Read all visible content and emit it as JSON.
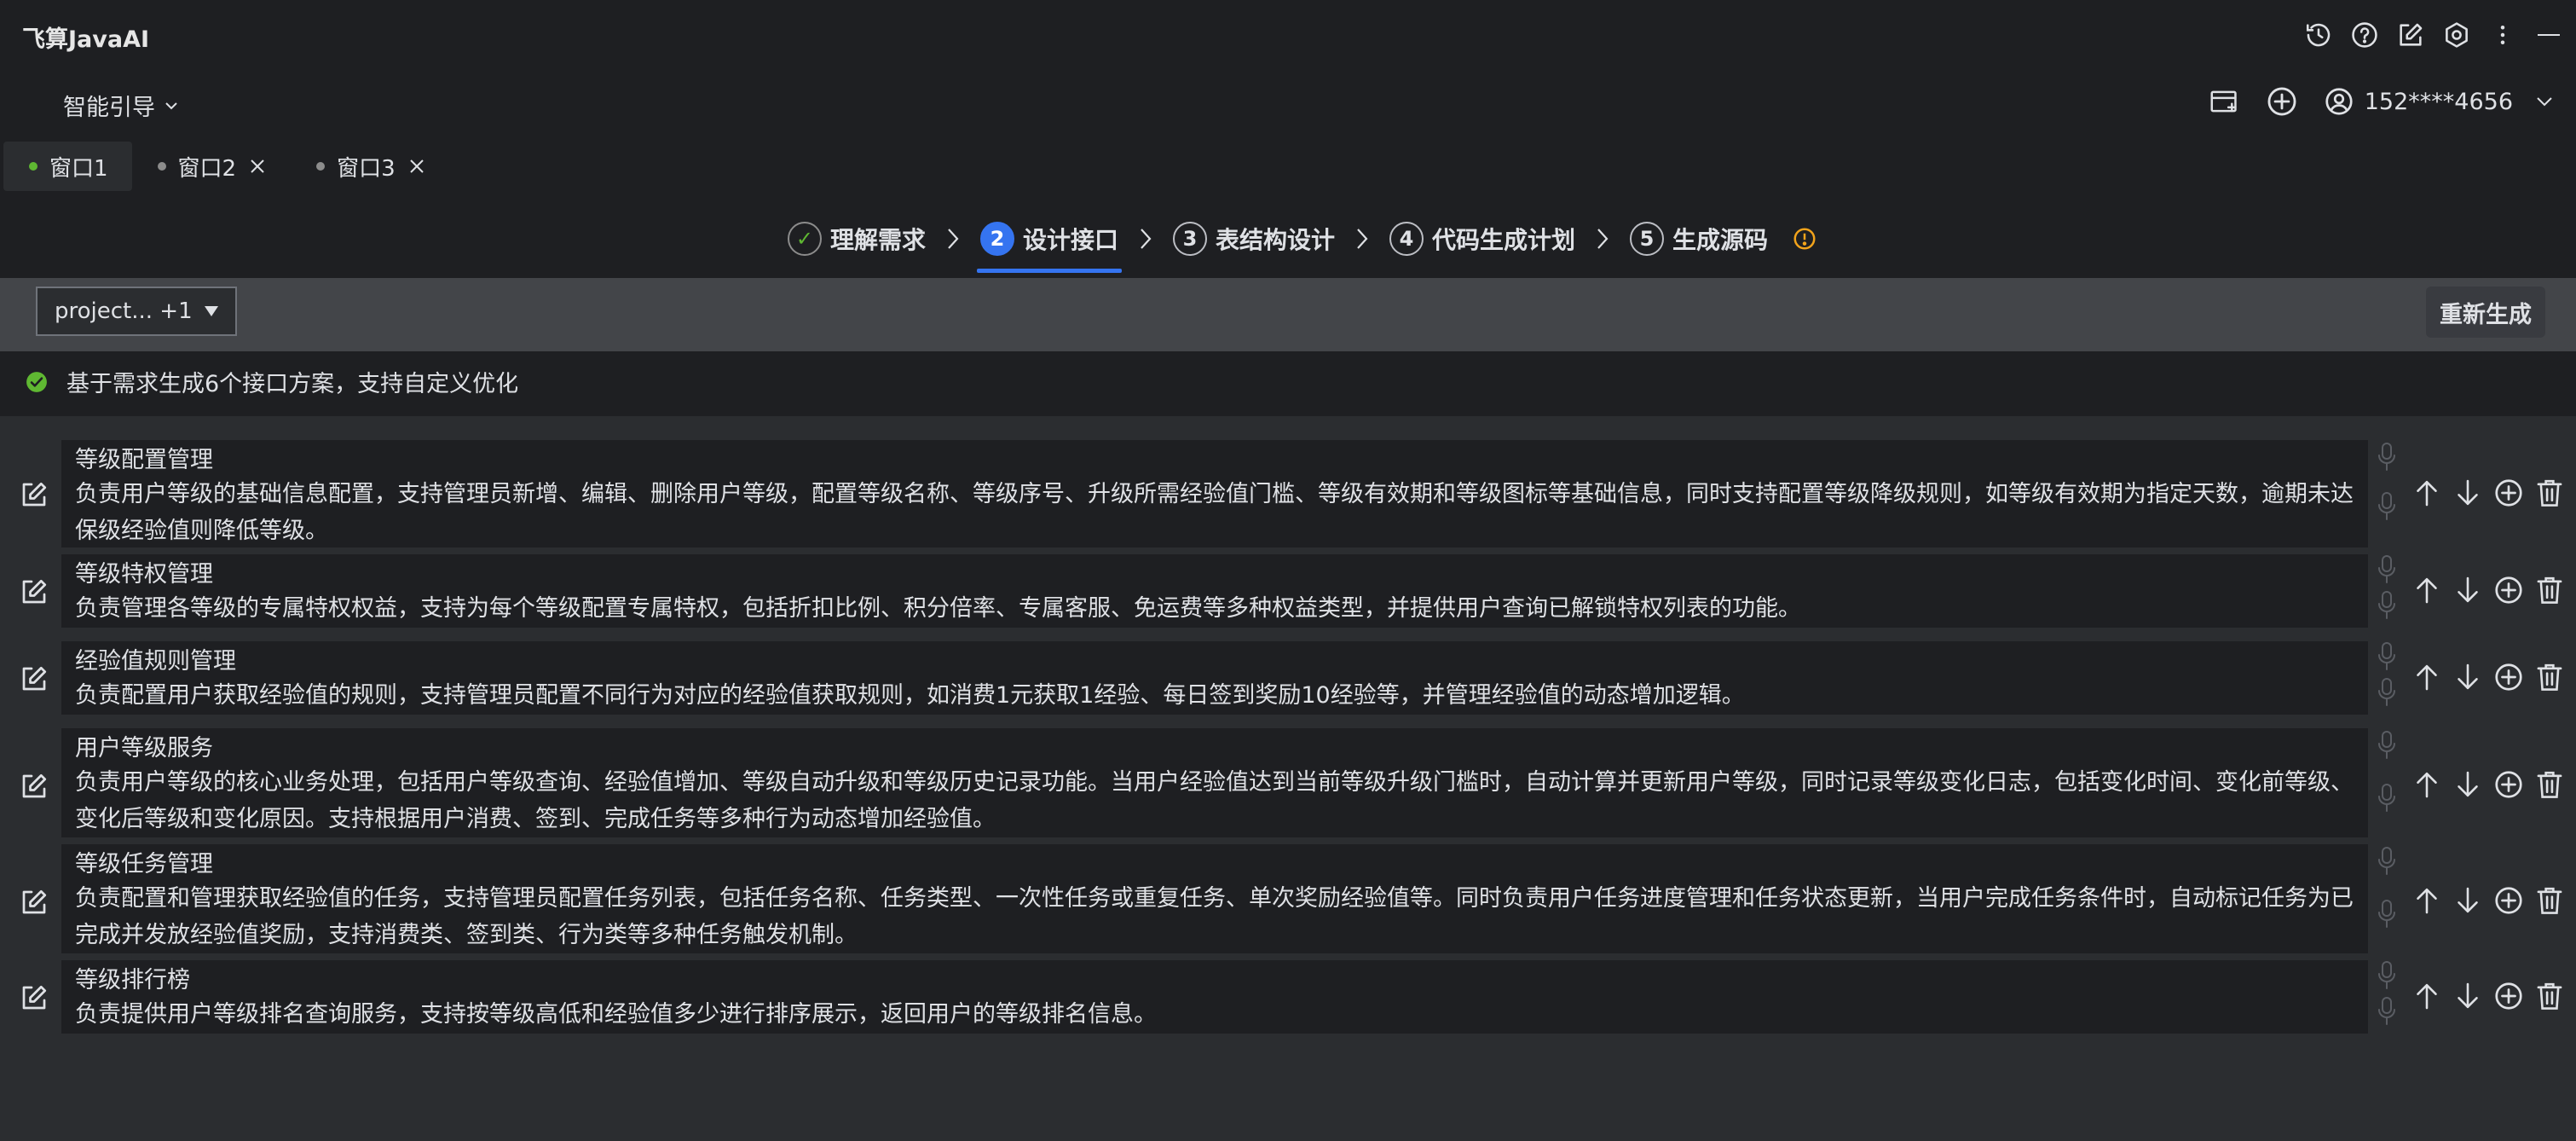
{
  "app": {
    "title": "飞算JavaAI"
  },
  "toolbar": {
    "guide_label": "智能引导",
    "user_phone": "152****4656"
  },
  "tabs": [
    {
      "label": "窗口1",
      "active": true,
      "closable": false
    },
    {
      "label": "窗口2",
      "active": false,
      "closable": true
    },
    {
      "label": "窗口3",
      "active": false,
      "closable": true
    }
  ],
  "steps": [
    {
      "num": "✓",
      "label": "理解需求",
      "state": "done"
    },
    {
      "num": "2",
      "label": "设计接口",
      "state": "current"
    },
    {
      "num": "3",
      "label": "表结构设计",
      "state": "todo"
    },
    {
      "num": "4",
      "label": "代码生成计划",
      "state": "todo"
    },
    {
      "num": "5",
      "label": "生成源码",
      "state": "todo"
    }
  ],
  "project": {
    "selected": "project... +1",
    "regenerate_label": "重新生成"
  },
  "notice": "基于需求生成6个接口方案，支持自定义优化",
  "interfaces": [
    {
      "title": "等级配置管理",
      "desc": "负责用户等级的基础信息配置，支持管理员新增、编辑、删除用户等级，配置等级名称、等级序号、升级所需经验值门槛、等级有效期和等级图标等基础信息，同时支持配置等级降级规则，如等级有效期为指定天数，逾期未达保级经验值则降低等级。"
    },
    {
      "title": "等级特权管理",
      "desc": "负责管理各等级的专属特权权益，支持为每个等级配置专属特权，包括折扣比例、积分倍率、专属客服、免运费等多种权益类型，并提供用户查询已解锁特权列表的功能。"
    },
    {
      "title": "经验值规则管理",
      "desc": "负责配置用户获取经验值的规则，支持管理员配置不同行为对应的经验值获取规则，如消费1元获取1经验、每日签到奖励10经验等，并管理经验值的动态增加逻辑。"
    },
    {
      "title": "用户等级服务",
      "desc": "负责用户等级的核心业务处理，包括用户等级查询、经验值增加、等级自动升级和等级历史记录功能。当用户经验值达到当前等级升级门槛时，自动计算并更新用户等级，同时记录等级变化日志，包括变化时间、变化前等级、变化后等级和变化原因。支持根据用户消费、签到、完成任务等多种行为动态增加经验值。"
    },
    {
      "title": "等级任务管理",
      "desc": "负责配置和管理获取经验值的任务，支持管理员配置任务列表，包括任务名称、任务类型、一次性任务或重复任务、单次奖励经验值等。同时负责用户任务进度管理和任务状态更新，当用户完成任务条件时，自动标记任务为已完成并发放经验值奖励，支持消费类、签到类、行为类等多种任务触发机制。"
    },
    {
      "title": "等级排行榜",
      "desc": "负责提供用户等级排名查询服务，支持按等级高低和经验值多少进行排序展示，返回用户的等级排名信息。"
    }
  ],
  "colors": {
    "accent": "#3574f0",
    "success": "#5fb832",
    "warning": "#f2a31b",
    "background": "#1e1f22",
    "panel": "#2b2d30"
  },
  "icons": [
    "history-icon",
    "help-icon",
    "edit-icon",
    "settings-icon",
    "more-icon",
    "minimize-icon",
    "new-window-icon",
    "add-icon",
    "user-icon",
    "chevron-down-icon",
    "close-icon",
    "chevron-right-icon",
    "info-icon",
    "check-circle-icon",
    "mic-icon",
    "arrow-up-icon",
    "arrow-down-icon",
    "add-circle-icon",
    "trash-icon"
  ]
}
